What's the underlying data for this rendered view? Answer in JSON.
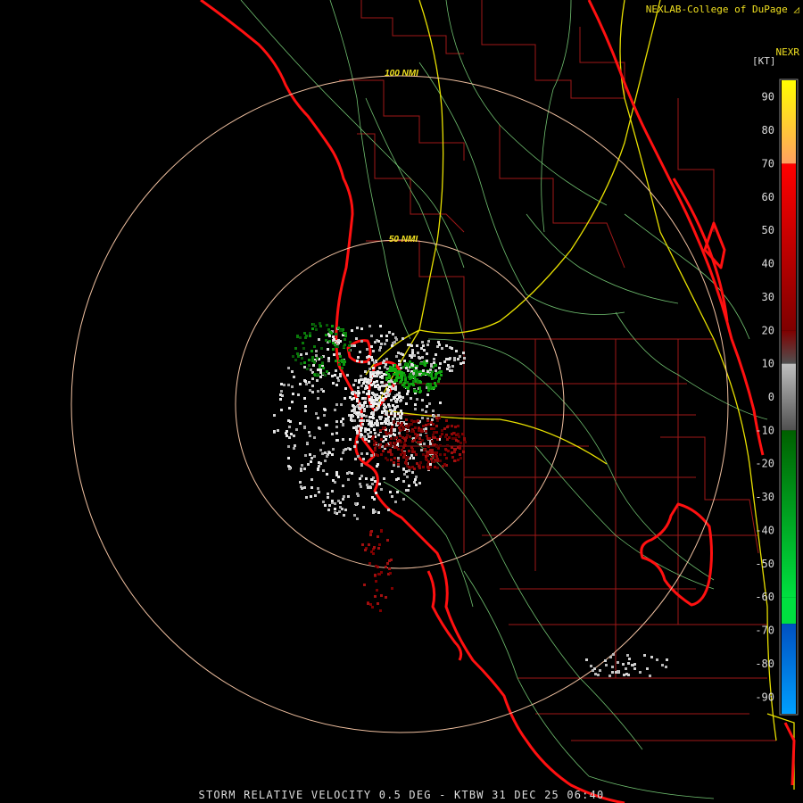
{
  "credit": "NEXLAB-College of DuPage",
  "legend": {
    "title": "NEXR",
    "unit": "[KT]",
    "ticks": [
      "90",
      "80",
      "70",
      "60",
      "50",
      "40",
      "30",
      "20",
      "10",
      "0",
      "-10",
      "-20",
      "-30",
      "-40",
      "-50",
      "-60",
      "-70",
      "-80",
      "-90"
    ],
    "range_max": 95,
    "range_min": -95,
    "colors": [
      "#ffff00",
      "#ffa060",
      "#ff0000",
      "#c00000",
      "#800000",
      "#505050",
      "#c0c0c0",
      "#006000",
      "#00c000",
      "#00e040",
      "#0050c0",
      "#00a0ff"
    ]
  },
  "range_rings": [
    {
      "label": "100 NMI",
      "radius_nmi": 100
    },
    {
      "label": "50 NMI",
      "radius_nmi": 50
    }
  ],
  "footer": "STORM RELATIVE VELOCITY 0.5 DEG - KTBW 31 DEC 25 06:40",
  "colors": {
    "background": "#000000",
    "coastline": "#ff1010",
    "county_lines": "#a01818",
    "highways": "#e8e000",
    "roads": "#70c070",
    "range_rings": "#f0c0a0",
    "text": "#dddddd",
    "accent_text": "#f0e020"
  }
}
